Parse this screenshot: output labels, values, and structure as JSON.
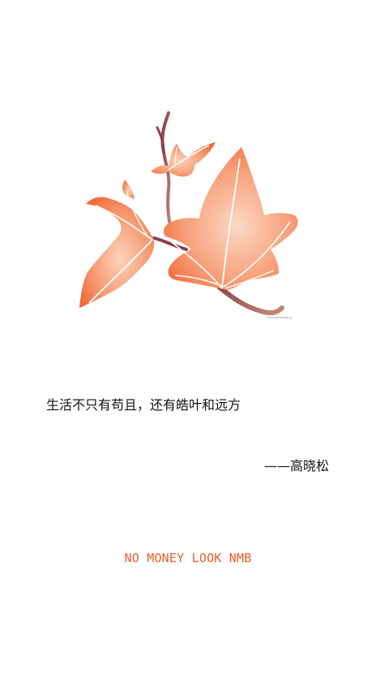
{
  "illustration": {
    "icon": "maple-leaf-illustration",
    "watermark": "hanhuamaoyang"
  },
  "quote": {
    "text": "生活不只有苟且，还有皓叶和远方",
    "author": "——高晓松"
  },
  "tagline": {
    "text": "NO MONEY LOOK NMB",
    "color": "#f05a2a"
  },
  "colors": {
    "leaf_edge": "#f26a3d",
    "leaf_center": "#fbd6c1",
    "stem": "#8a3e4f",
    "vein": "#ffffff"
  }
}
